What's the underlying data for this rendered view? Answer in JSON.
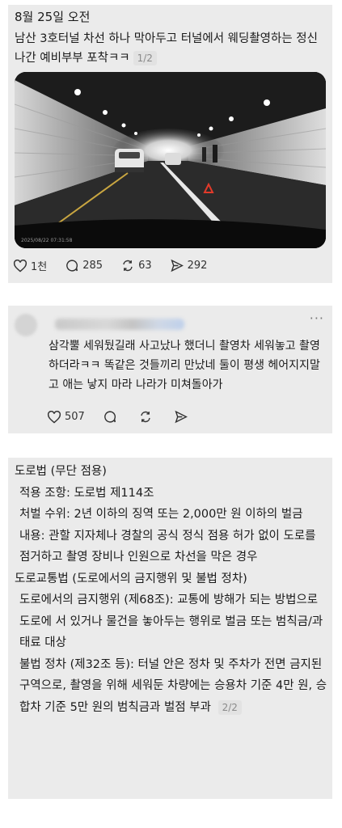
{
  "post": {
    "date": "8월 25일 오전",
    "text": "남산 3호터널 차선 하나 막아두고 터널에서 웨딩촬영하는 정신 나간 예비부부 포착ㅋㅋ",
    "pager": "1/2",
    "stats": {
      "likes": "1천",
      "replies": "285",
      "reposts": "63",
      "shares": "292"
    }
  },
  "comment": {
    "more": "···",
    "text": "삼각뿔 세워뒀길래 사고났나 했더니 촬영차 세워놓고 촬영하더라ㅋㅋ 똑같은 것들끼리 만났네 둘이 평생 헤어지지말고 애는 낳지 마라 나라가 미쳐돌아가",
    "likes": "507"
  },
  "law": {
    "lines": [
      "도로법 (무단 점용)",
      " 적용 조항: 도로법 제114조",
      " 처벌 수위: 2년 이하의 징역 또는 2,000만 원 이하의 벌금",
      " 내용: 관할 지자체나 경찰의 공식 정식 점용 허가 없이 도로를 점거하고 촬영 장비나 인원으로 차선을 막은 경우",
      "도로교통법 (도로에서의 금지행위 및 불법 정차)",
      " 도로에서의 금지행위 (제68조): 교통에 방해가 되는 방법으로 도로에 서 있거나 물건을 놓아두는 행위로 벌금 또는 범칙금/과태료 대상",
      " 불법 정차 (제32조 등): 터널 안은 정차 및 주차가 전면 금지된 구역으로, 촬영을 위해 세워둔 차량에는 승용차 기준 4만 원, 승합차 기준 5만 원의 범칙금과 벌점 부과"
    ],
    "pager": "2/2"
  },
  "video_timestamp": "2025/08/22 07:31:58"
}
